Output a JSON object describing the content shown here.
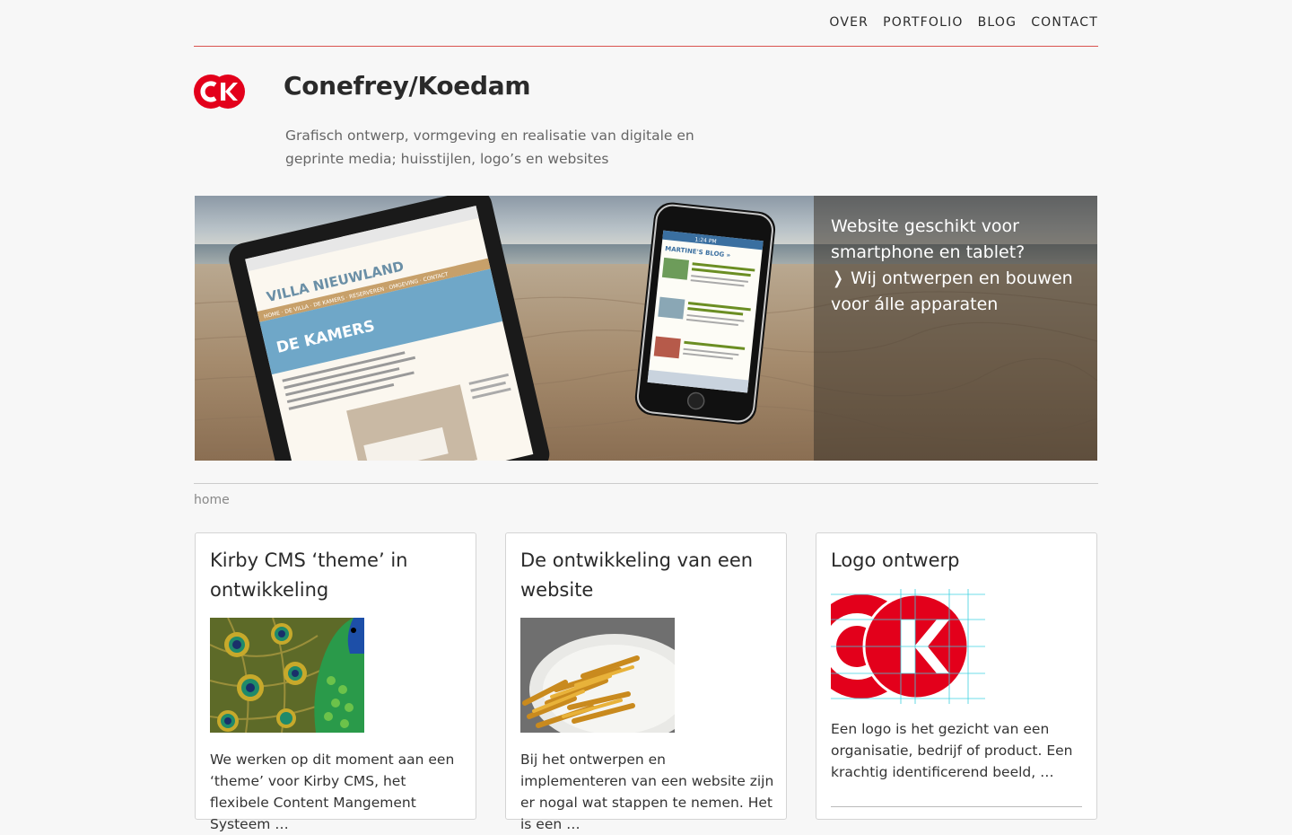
{
  "nav": {
    "items": [
      "OVER",
      "PORTFOLIO",
      "BLOG",
      "CONTACT"
    ]
  },
  "brand": {
    "logo_letters": "CK",
    "title": "Conefrey/Koedam",
    "tagline": "Grafisch ontwerp, vormgeving en realisatie van digitale en geprinte media; huisstijlen, logo’s en websites",
    "accent_color": "#e3001b"
  },
  "hero": {
    "line1": "Website geschikt voor smartphone en tablet?",
    "line2": "❭ Wij ontwerpen en bouwen voor álle apparaten",
    "tablet_screen": {
      "site_name": "VILLA NIEUWLAND",
      "heading": "DE KAMERS",
      "menu": "HOME · DE VILLA · DE KAMERS · RESERVEREN · OMGEVING · CONTACT"
    },
    "phone_screen": {
      "blog_title": "MARTINE'S BLOG »",
      "time": "1:24 PM"
    }
  },
  "breadcrumb": "home",
  "cards": [
    {
      "title": "Kirby CMS ‘theme’ in ontwikkeling",
      "image_icon": "peacock-feathers-image",
      "excerpt": "We werken op dit moment aan een ‘theme’ voor Kirby CMS, het flexibele Content Mangement Systeem …"
    },
    {
      "title": "De ontwikkeling van een website",
      "image_icon": "french-fries-image",
      "excerpt": "Bij het ontwerpen en implementeren van een website zijn er nogal wat stappen te nemen. Het is een …"
    },
    {
      "title": "Logo ontwerp",
      "image_icon": "ck-logo-construction-image",
      "excerpt": "Een logo is het gezicht van een organisatie, bedrijf of product. Een krachtig identificerend beeld, …"
    }
  ]
}
